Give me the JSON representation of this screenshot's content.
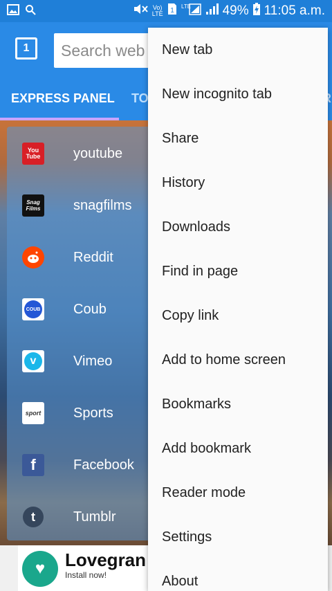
{
  "status_bar": {
    "battery": "49%",
    "time": "11:05 a.m.",
    "network": "LTE"
  },
  "toolbar": {
    "tab_count": "1",
    "search_placeholder": "Search web"
  },
  "tabs": [
    {
      "label": "EXPRESS PANEL"
    },
    {
      "label": "TO"
    },
    {
      "label": "R"
    }
  ],
  "express_panel": {
    "sites": [
      {
        "name": "youtube",
        "logo": "You Tube",
        "color": "#d81f26"
      },
      {
        "name": "snagfilms",
        "logo": "Snag Films",
        "color": "#111111"
      },
      {
        "name": "Reddit",
        "logo": "reddit-icon",
        "color": "#ff4500"
      },
      {
        "name": "Coub",
        "logo": "COUB",
        "color": "#2457d6"
      },
      {
        "name": "Vimeo",
        "logo": "vimeo-icon",
        "color": "#1ab7ea"
      },
      {
        "name": "Sports",
        "logo": "sport",
        "color": "#ffffff"
      },
      {
        "name": "Facebook",
        "logo": "f",
        "color": "#3b5998"
      },
      {
        "name": "Tumblr",
        "logo": "t",
        "color": "#35465c"
      }
    ]
  },
  "ad": {
    "title": "Lovegran",
    "subtitle": "Install now!"
  },
  "menu": {
    "items": [
      {
        "label": "New tab"
      },
      {
        "label": "New incognito tab"
      },
      {
        "label": "Share"
      },
      {
        "label": "History"
      },
      {
        "label": "Downloads"
      },
      {
        "label": "Find in page"
      },
      {
        "label": "Copy link"
      },
      {
        "label": "Add to home screen"
      },
      {
        "label": "Bookmarks"
      },
      {
        "label": "Add bookmark"
      },
      {
        "label": "Reader mode"
      },
      {
        "label": "Settings"
      },
      {
        "label": "About"
      }
    ]
  }
}
